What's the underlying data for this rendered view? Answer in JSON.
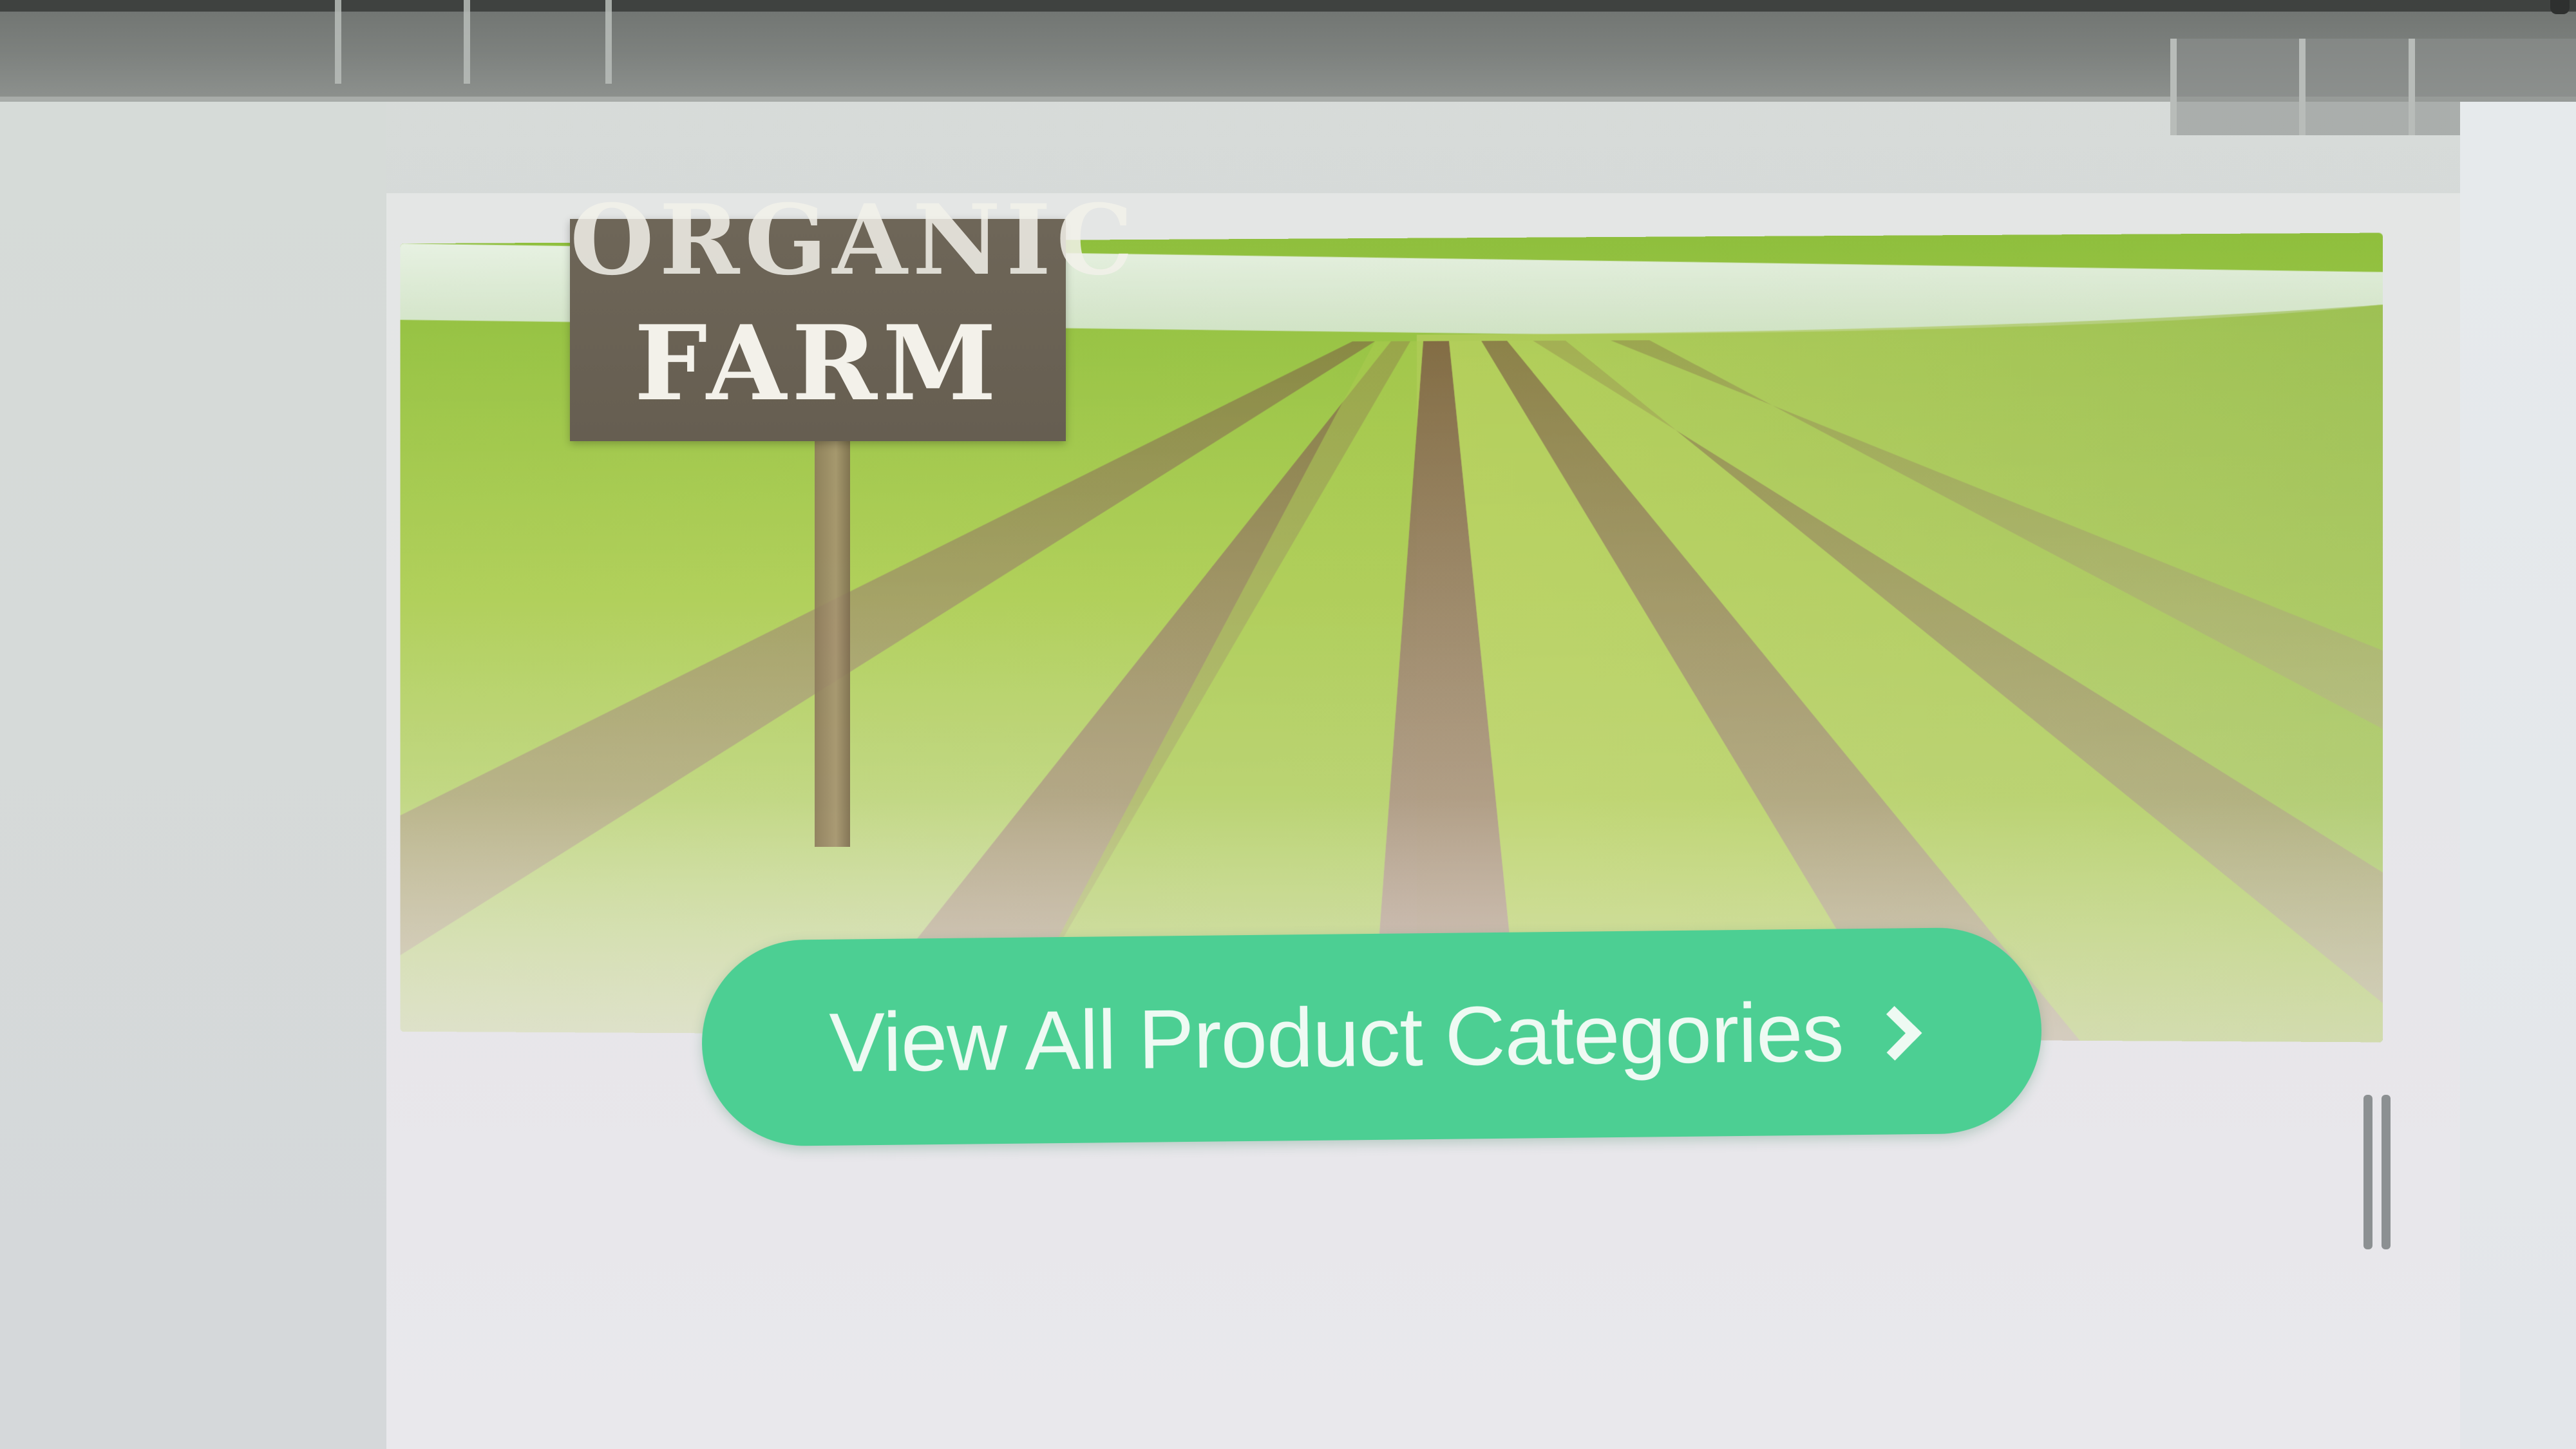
{
  "banner": {
    "sign_line1": "ORGANIC",
    "sign_line2": "FARM"
  },
  "cta": {
    "label": "View All Product Categories",
    "icon": "chevron-right-icon",
    "color": "#4ccf93"
  },
  "scrollbar": {
    "icon": "grip-lines-icon"
  }
}
